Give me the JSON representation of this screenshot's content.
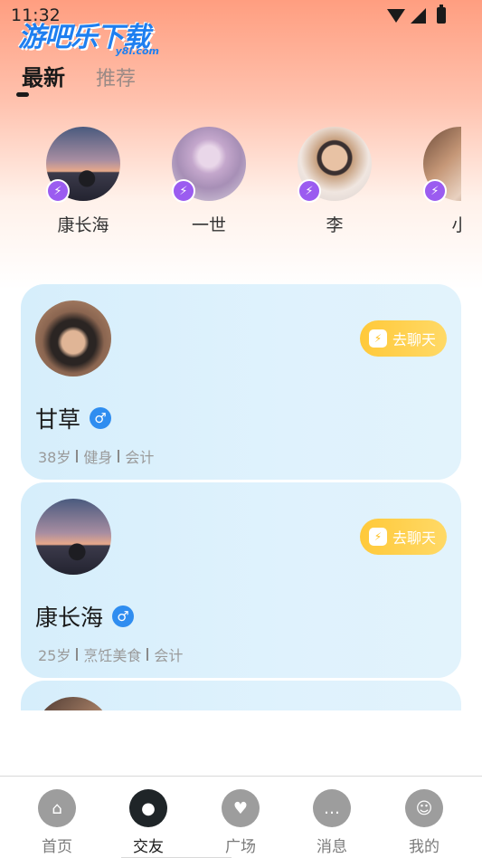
{
  "status_bar": {
    "time": "11:32"
  },
  "watermark": {
    "main": "游吧乐下载",
    "sub": "y8l.com"
  },
  "tabs": [
    {
      "label": "最新",
      "active": true
    },
    {
      "label": "推荐",
      "active": false
    }
  ],
  "stories": [
    {
      "name": "康长海",
      "avatar": "sunset-silhouette"
    },
    {
      "name": "一世",
      "avatar": "girl-portrait"
    },
    {
      "name": "李",
      "avatar": "man-glasses"
    },
    {
      "name": "小",
      "avatar": "room-partial"
    }
  ],
  "cards": [
    {
      "name": "甘草",
      "age": "38岁",
      "hobby": "健身",
      "job": "会计",
      "gender_icon": "male-icon",
      "chat_label": "去聊天"
    },
    {
      "name": "康长海",
      "age": "25岁",
      "hobby": "烹饪美食",
      "job": "会计",
      "gender_icon": "male-icon",
      "chat_label": "去聊天"
    }
  ],
  "bottom_nav": [
    {
      "label": "首页",
      "icon": "home-icon",
      "active": false
    },
    {
      "label": "交友",
      "icon": "location-pin-icon",
      "active": true
    },
    {
      "label": "广场",
      "icon": "heart-icon",
      "active": false
    },
    {
      "label": "消息",
      "icon": "chat-bubble-icon",
      "active": false
    },
    {
      "label": "我的",
      "icon": "person-icon",
      "active": false
    }
  ],
  "colors": {
    "accent_chat": "#ffc93a",
    "story_badge": "#9b5cf0",
    "gender_male": "#2f8df0",
    "card_bg": "#d6eefb"
  }
}
